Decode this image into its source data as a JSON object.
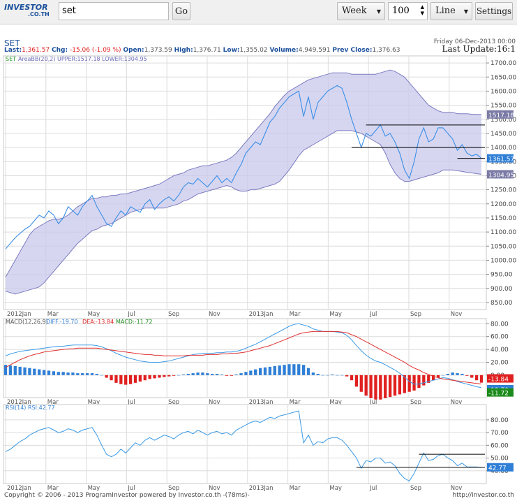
{
  "toolbar": {
    "logo_text": "INVESTOR",
    "logo_sub": ".CO.TH",
    "search_value": "set",
    "go_label": "Go",
    "period": "Week",
    "count": "100",
    "chart_style": "Line",
    "settings_label": "Settings"
  },
  "header": {
    "symbol": "SET",
    "last_label": "Last:",
    "last": "1,361.57",
    "chg_label": "Chg:",
    "chg": "-15.06 (-1.09 %)",
    "open_label": "Open:",
    "open": "1,373.59",
    "high_label": "High:",
    "high": "1,376.71",
    "low_label": "Low:",
    "low": "1,355.02",
    "volume_label": "Volume:",
    "volume": "4,949,591",
    "prev_label": "Prev Close:",
    "prev": "1,376.63",
    "date": "Friday 06-Dec-2013 00:00",
    "last_update": "Last Update:16:1"
  },
  "footer": {
    "copyright": "Copyright © 2006 - 2013 ProgramInvestor powered by Investor.co.th  -(78ms)-",
    "url": "http://investor.co.th"
  },
  "colors": {
    "price": "#3a8ee6",
    "band": "#c8c8ec",
    "band_line": "#7b7bc0",
    "macd_pos": "#2f7fd6",
    "macd_neg": "#e02020",
    "dea": "#e03030",
    "grid": "#dcdcdc"
  },
  "chart_data": [
    {
      "type": "line",
      "title": "SET",
      "legend": [
        "SET",
        "AreaBB(20,2) UPPER:1517.18 LOWER:1304.95"
      ],
      "x_labels": [
        "2012Jan",
        "Mar",
        "May",
        "Jul",
        "Sep",
        "Nov",
        "2013Jan",
        "Mar",
        "May",
        "Jul",
        "Sep",
        "Nov"
      ],
      "ylim": [
        825,
        1725
      ],
      "y_ticks": [
        "850.00",
        "900.00",
        "950.00",
        "1000.00",
        "1050.00",
        "1100.00",
        "1150.00",
        "1200.00",
        "1250.00",
        "1300.00",
        "1350.00",
        "1400.00",
        "1450.00",
        "1500.00",
        "1550.00",
        "1600.00",
        "1650.00",
        "1700.00"
      ],
      "series": [
        {
          "name": "SET",
          "values": [
            1040,
            1060,
            1080,
            1095,
            1110,
            1120,
            1140,
            1160,
            1150,
            1175,
            1160,
            1130,
            1150,
            1190,
            1175,
            1160,
            1190,
            1210,
            1230,
            1190,
            1160,
            1130,
            1120,
            1150,
            1175,
            1160,
            1190,
            1180,
            1170,
            1200,
            1215,
            1180,
            1200,
            1215,
            1225,
            1210,
            1230,
            1260,
            1275,
            1270,
            1290,
            1275,
            1260,
            1280,
            1300,
            1275,
            1290,
            1275,
            1310,
            1340,
            1380,
            1400,
            1420,
            1410,
            1450,
            1490,
            1510,
            1540,
            1560,
            1580,
            1590,
            1600,
            1510,
            1580,
            1500,
            1560,
            1580,
            1600,
            1610,
            1620,
            1610,
            1560,
            1500,
            1450,
            1400,
            1450,
            1440,
            1460,
            1480,
            1440,
            1450,
            1420,
            1380,
            1320,
            1290,
            1350,
            1430,
            1470,
            1420,
            1430,
            1470,
            1470,
            1450,
            1430,
            1390,
            1410,
            1380,
            1370,
            1376,
            1361.57
          ]
        },
        {
          "name": "UPPER",
          "values": [
            940,
            970,
            1000,
            1030,
            1060,
            1090,
            1110,
            1120,
            1130,
            1140,
            1145,
            1145,
            1150,
            1160,
            1175,
            1190,
            1200,
            1210,
            1220,
            1220,
            1225,
            1225,
            1230,
            1230,
            1235,
            1235,
            1240,
            1245,
            1250,
            1255,
            1260,
            1265,
            1270,
            1280,
            1290,
            1300,
            1305,
            1310,
            1320,
            1325,
            1330,
            1335,
            1335,
            1340,
            1345,
            1350,
            1355,
            1365,
            1380,
            1400,
            1420,
            1440,
            1460,
            1480,
            1500,
            1520,
            1545,
            1565,
            1585,
            1600,
            1610,
            1620,
            1630,
            1640,
            1645,
            1650,
            1655,
            1660,
            1665,
            1665,
            1665,
            1665,
            1660,
            1660,
            1660,
            1660,
            1660,
            1660,
            1665,
            1670,
            1675,
            1670,
            1660,
            1650,
            1630,
            1610,
            1590,
            1570,
            1550,
            1540,
            1530,
            1525,
            1525,
            1525,
            1520,
            1520,
            1520,
            1518,
            1517.5,
            1517.18
          ]
        },
        {
          "name": "LOWER",
          "values": [
            890,
            885,
            880,
            885,
            890,
            895,
            900,
            905,
            920,
            940,
            960,
            980,
            1000,
            1020,
            1040,
            1060,
            1075,
            1090,
            1105,
            1110,
            1120,
            1125,
            1130,
            1140,
            1150,
            1160,
            1170,
            1175,
            1180,
            1185,
            1185,
            1185,
            1185,
            1185,
            1190,
            1195,
            1200,
            1210,
            1215,
            1225,
            1235,
            1240,
            1245,
            1250,
            1255,
            1260,
            1265,
            1260,
            1250,
            1245,
            1245,
            1250,
            1250,
            1255,
            1260,
            1265,
            1270,
            1280,
            1300,
            1320,
            1345,
            1370,
            1390,
            1400,
            1410,
            1420,
            1430,
            1440,
            1450,
            1460,
            1460,
            1460,
            1460,
            1455,
            1450,
            1440,
            1430,
            1420,
            1410,
            1380,
            1340,
            1310,
            1290,
            1280,
            1280,
            1285,
            1290,
            1295,
            1300,
            1305,
            1310,
            1320,
            1320,
            1320,
            1318,
            1315,
            1312,
            1310,
            1307,
            1304.95
          ]
        }
      ],
      "value_labels": [
        "1517.18",
        "1361.57",
        "1304.95"
      ],
      "levels": [
        1480,
        1400,
        1361.57
      ]
    },
    {
      "type": "bar",
      "title": "MACD(12,26,9)",
      "legend": [
        "MACD(12,26,9)",
        "DIFF:-19.70",
        "DEA:-13.84",
        "MACD:-11.72"
      ],
      "ylim": [
        -35,
        88
      ],
      "y_ticks": [
        "0.00",
        "20.00",
        "40.00",
        "60.00",
        "80.00"
      ],
      "value_labels": [
        "-13.84",
        "-19.70",
        "-11.72"
      ],
      "diff": [
        30,
        33,
        35,
        37,
        38,
        39,
        40,
        41,
        42,
        43,
        44,
        45,
        45,
        46,
        47,
        47,
        47,
        47,
        47,
        46,
        44,
        41,
        38,
        34,
        31,
        28,
        26,
        24,
        22,
        21,
        20,
        20,
        20,
        21,
        22,
        24,
        26,
        28,
        30,
        32,
        33,
        34,
        34,
        34,
        35,
        35,
        36,
        36,
        37,
        39,
        42,
        45,
        48,
        52,
        56,
        60,
        64,
        68,
        72,
        76,
        79,
        80,
        78,
        76,
        72,
        70,
        68,
        68,
        68,
        67,
        66,
        62,
        55,
        46,
        38,
        31,
        26,
        22,
        20,
        16,
        12,
        8,
        3,
        -3,
        -10,
        -14,
        -14,
        -12,
        -10,
        -8,
        -6,
        -4,
        -5,
        -7,
        -10,
        -12,
        -14,
        -16,
        -18,
        -19.7
      ],
      "dea": [
        12,
        16,
        20,
        24,
        27,
        30,
        32,
        34,
        36,
        37,
        38,
        39,
        40,
        41,
        41,
        42,
        42,
        42,
        42,
        42,
        41,
        40,
        39,
        38,
        37,
        36,
        35,
        34,
        33,
        32,
        32,
        31,
        31,
        30,
        30,
        30,
        30,
        30,
        31,
        31,
        31,
        31,
        32,
        32,
        32,
        33,
        33,
        34,
        34,
        35,
        36,
        38,
        40,
        42,
        44,
        46,
        49,
        52,
        55,
        58,
        61,
        64,
        66,
        67,
        68,
        68,
        68,
        68,
        68,
        68,
        67,
        66,
        63,
        60,
        56,
        52,
        48,
        44,
        40,
        36,
        32,
        28,
        24,
        20,
        15,
        11,
        8,
        4,
        1,
        -2,
        -4,
        -6,
        -7,
        -8,
        -9,
        -10,
        -11,
        -12,
        -13,
        -13.84
      ],
      "hist": [
        16,
        15,
        14,
        13,
        12,
        11,
        10,
        9,
        8,
        7,
        6,
        5,
        5,
        4,
        4,
        3,
        3,
        3,
        3,
        2,
        0,
        -4,
        -8,
        -12,
        -14,
        -15,
        -14,
        -12,
        -10,
        -8,
        -6,
        -5,
        -4,
        -3,
        -2,
        -1,
        0,
        1,
        2,
        3,
        4,
        4,
        3,
        2,
        2,
        1,
        -1,
        -1,
        1,
        3,
        5,
        7,
        9,
        11,
        12,
        13,
        14,
        15,
        16,
        17,
        17,
        17,
        16,
        11,
        4,
        2,
        0,
        0,
        1,
        0,
        0,
        -2,
        -8,
        -18,
        -26,
        -32,
        -36,
        -38,
        -38,
        -36,
        -34,
        -32,
        -30,
        -28,
        -26,
        -24,
        -20,
        -16,
        -12,
        -8,
        -4,
        0,
        2,
        4,
        3,
        2,
        -1,
        -4,
        -8,
        -11.72
      ]
    },
    {
      "type": "line",
      "title": "RSI(14)",
      "legend": [
        "RSI(14) RSI:42.77"
      ],
      "ylim": [
        30,
        92
      ],
      "y_ticks": [
        "40.00",
        "50.00",
        "60.00",
        "70.00",
        "80.00"
      ],
      "value_labels": [
        "42.77"
      ],
      "levels": [
        53,
        42.77
      ],
      "values": [
        55,
        57,
        60,
        63,
        65,
        68,
        70,
        72,
        73,
        74,
        72,
        70,
        71,
        73,
        72,
        70,
        72,
        73,
        74,
        68,
        60,
        53,
        51,
        53,
        57,
        54,
        58,
        62,
        60,
        64,
        66,
        64,
        66,
        68,
        67,
        65,
        68,
        70,
        71,
        69,
        72,
        70,
        68,
        70,
        71,
        69,
        70,
        68,
        72,
        74,
        76,
        78,
        79,
        78,
        80,
        82,
        81,
        83,
        84,
        85,
        86,
        87,
        62,
        68,
        60,
        63,
        62,
        65,
        66,
        66,
        64,
        60,
        55,
        50,
        42,
        48,
        47,
        50,
        50,
        46,
        47,
        44,
        38,
        34,
        32,
        38,
        46,
        54,
        48,
        49,
        52,
        53,
        50,
        48,
        44,
        46,
        43,
        43,
        43,
        42.77
      ]
    }
  ]
}
